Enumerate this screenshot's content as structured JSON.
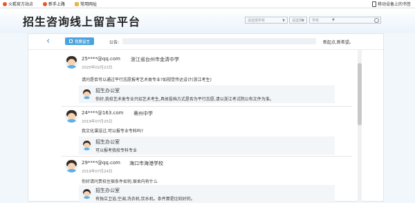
{
  "bookmarks": {
    "items": [
      {
        "label": "火狐官方站点",
        "icon": "firefox-icon"
      },
      {
        "label": "新手上路",
        "icon": "firefox-icon"
      },
      {
        "label": "常用网址",
        "icon": "folder-icon"
      }
    ],
    "mobile_label": "移动设备上的书签"
  },
  "header": {
    "title": "招生咨询线上留言平台",
    "select1": "请选择学校",
    "select2": "请选择",
    "search_label": "学校"
  },
  "toolbar": {
    "message_button": "我要留言",
    "notice_label": "公告:",
    "notice_text": "新起点,新希望。"
  },
  "messages": [
    {
      "user": "25****@qq.com",
      "school": "浙江省台州市金清中学",
      "date": "2020年02月23日",
      "question": "请问是否可以通过平行志愿报考艺术类专业?如视觉传达设计(浙江考生)",
      "reply_name": "招生办公室",
      "reply_text": "你好,我校艺术类专业只招艺术考生,具体投档方式是否为平行志愿,请以浙江考试院公布文件为准。"
    },
    {
      "user": "24****@163.com",
      "school": "蒂州中学",
      "date": "2019年07月25日",
      "question": "我文化课没过,可以报专业专科吗?",
      "reply_name": "招生办公室",
      "reply_text": "可以报考我校专科专业"
    },
    {
      "user": "29****@qq.com",
      "school": "海口市海港学校",
      "date": "2019年07月24日",
      "question": "你好请问贵校住宿条件如何,宿舍内有什么",
      "reply_name": "招生办公室",
      "reply_text": "有独立卫浴,空调,洗衣机,饮水机。条件算是比较好的。"
    }
  ]
}
